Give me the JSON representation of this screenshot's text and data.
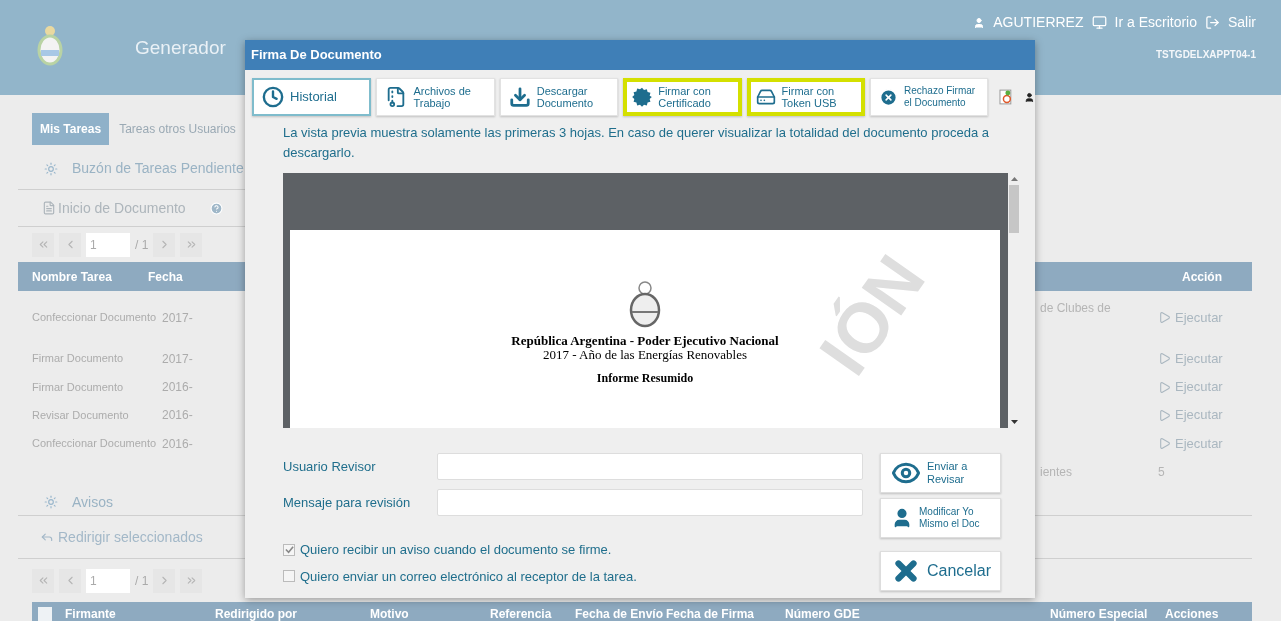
{
  "header": {
    "title": "Generador",
    "user": "AGUTIERREZ",
    "desktop_link": "Ir a Escritorio",
    "logout": "Salir",
    "server": "TSTGDELXAPPT04-1"
  },
  "tabs": [
    {
      "label": "Mis Tareas",
      "selected": true
    },
    {
      "label": "Tareas otros Usuarios",
      "selected": false
    }
  ],
  "pending_section": {
    "title": "Buzón de Tareas Pendiente",
    "action": "Inicio de Documento"
  },
  "pager_top": {
    "page": "1",
    "total": "/ 1"
  },
  "tasks_table": {
    "columns": [
      "Nombre Tarea",
      "Fecha",
      "Acción"
    ],
    "rows": [
      {
        "name": "Confeccionar Documento",
        "date": "2017-",
        "detail": "de Clubes de",
        "action": "Ejecutar"
      },
      {
        "name": "Firmar Documento",
        "date": "2017-",
        "action": "Ejecutar"
      },
      {
        "name": "Firmar Documento",
        "date": "2016-",
        "action": "Ejecutar"
      },
      {
        "name": "Revisar Documento",
        "date": "2016-",
        "action": "Ejecutar"
      },
      {
        "name": "Confeccionar Documento",
        "date": "2016-",
        "action": "Ejecutar"
      }
    ],
    "footer": {
      "label": "ientes",
      "value": "5"
    }
  },
  "notices_section": {
    "title": "Avisos",
    "action": "Redirigir seleccionados"
  },
  "pager_bottom": {
    "page": "1",
    "total": "/ 1"
  },
  "notices_table": {
    "select_all_checked": false,
    "columns": [
      "Firmante",
      "Redirigido por",
      "Motivo",
      "Referencia",
      "Fecha de Envío",
      "Fecha de Firma",
      "Número GDE",
      "Número Especial",
      "Acciones"
    ]
  },
  "dialog": {
    "title": "Firma De Documento",
    "toolbar": [
      {
        "kind": "history",
        "label": "Historial",
        "selected": true,
        "highlighted": false
      },
      {
        "kind": "files",
        "label": "Archivos de Trabajo",
        "selected": false,
        "highlighted": false
      },
      {
        "kind": "download",
        "label": "Descargar Documento",
        "selected": false,
        "highlighted": false
      },
      {
        "kind": "certificate",
        "label": "Firmar con Certificado",
        "selected": false,
        "highlighted": true
      },
      {
        "kind": "token",
        "label": "Firmar con Token USB",
        "selected": false,
        "highlighted": true
      },
      {
        "kind": "reject",
        "label": "Rechazo Firmar el Documento",
        "selected": false,
        "highlighted": false
      }
    ],
    "notice": "La vista previa muestra solamente las primeras 3 hojas. En caso de querer visualizar la totalidad del documento proceda a descargarlo.",
    "preview": {
      "heading": "República Argentina - Poder Ejecutivo Nacional",
      "subheading": "2017 - Año de las Energías Renovables",
      "doc_title": "Informe Resumido",
      "stamp": "IÓN"
    },
    "fields": [
      {
        "label": "Usuario Revisor"
      },
      {
        "label": "Mensaje para revisión"
      }
    ],
    "options": [
      {
        "label": "Quiero recibir un aviso cuando el documento se firme.",
        "checked": true
      },
      {
        "label": "Quiero enviar un correo electrónico al receptor de la tarea.",
        "checked": false
      }
    ],
    "buttons": [
      {
        "kind": "review",
        "label": "Enviar a Revisar"
      },
      {
        "kind": "self",
        "label": "Modificar Yo Mismo el Doc"
      },
      {
        "kind": "cancel",
        "label": "Cancelar"
      }
    ]
  }
}
